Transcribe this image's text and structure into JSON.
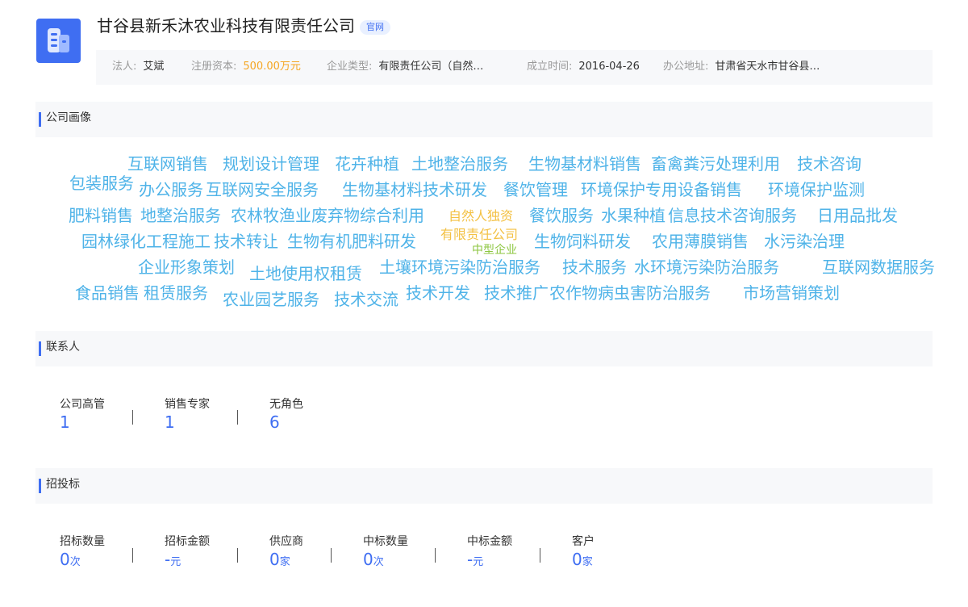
{
  "company": {
    "name": "甘谷县新禾沐农业科技有限责任公司",
    "official_badge": "官网"
  },
  "info": [
    {
      "label": "法人:",
      "value": "艾斌"
    },
    {
      "label": "注册资本:",
      "value": "500.00万元"
    },
    {
      "label": "企业类型:",
      "value": "有限责任公司（自然…"
    },
    {
      "label": "成立时间:",
      "value": "2016-04-26"
    },
    {
      "label": "办公地址:",
      "value": "甘肃省天水市甘谷县…"
    }
  ],
  "portrait": {
    "title": "公司画像",
    "tags": [
      "互联网销售",
      "规划设计管理",
      "花卉种植",
      "土地整治服务",
      "生物基材料销售",
      "畜禽粪污处理利用",
      "技术咨询",
      "包装服务",
      "办公服务",
      "互联网安全服务",
      "生物基材料技术研发",
      "餐饮管理",
      "环境保护专用设备销售",
      "环境保护监测",
      "肥料销售",
      "地整治服务",
      "农林牧渔业废弃物综合利用",
      "自然人独资",
      "餐饮服务",
      "水果种植",
      "信息技术咨询服务",
      "日用品批发",
      "园林绿化工程施工",
      "技术转让",
      "生物有机肥料研发",
      "有限责任公司",
      "中型企业",
      "生物饲料研发",
      "农用薄膜销售",
      "水污染治理",
      "企业形象策划",
      "土地使用权租赁",
      "土壤环境污染防治服务",
      "技术服务",
      "水环境污染防治服务",
      "互联网数据服务",
      "食品销售",
      "租赁服务",
      "农业园艺服务",
      "技术交流",
      "技术开发",
      "技术推广",
      "农作物病虫害防治服务",
      "市场营销策划"
    ]
  },
  "contacts": {
    "title": "联系人",
    "stats": [
      {
        "label": "公司高管",
        "value": "1"
      },
      {
        "label": "销售专家",
        "value": "1"
      },
      {
        "label": "无角色",
        "value": "6"
      }
    ]
  },
  "bidding": {
    "title": "招投标",
    "stats": [
      {
        "label": "招标数量",
        "value": "0",
        "unit": "次"
      },
      {
        "label": "招标金额",
        "value": "-",
        "unit": "元"
      },
      {
        "label": "供应商",
        "value": "0",
        "unit": "家"
      },
      {
        "label": "中标数量",
        "value": "0",
        "unit": "次"
      },
      {
        "label": "中标金额",
        "value": "-",
        "unit": "元"
      },
      {
        "label": "客户",
        "value": "0",
        "unit": "家"
      }
    ]
  }
}
